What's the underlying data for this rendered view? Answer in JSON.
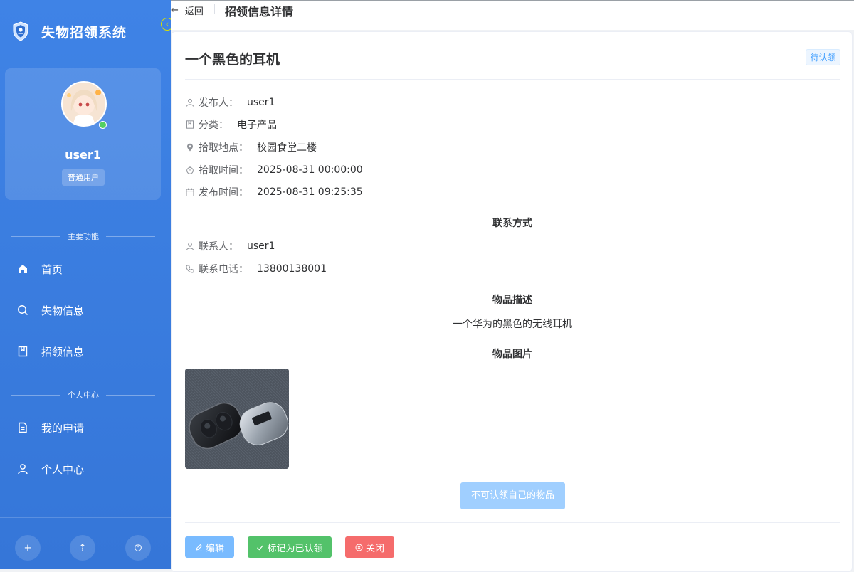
{
  "app": {
    "title": "失物招领系统"
  },
  "user": {
    "name": "user1",
    "role": "普通用户"
  },
  "sidebar": {
    "main_section": "主要功能",
    "personal_section": "个人中心",
    "main_items": [
      {
        "label": "首页",
        "icon": "home-icon"
      },
      {
        "label": "失物信息",
        "icon": "search-icon"
      },
      {
        "label": "招领信息",
        "icon": "bookmark-icon"
      }
    ],
    "personal_items": [
      {
        "label": "我的申请",
        "icon": "document-icon"
      },
      {
        "label": "个人中心",
        "icon": "user-icon"
      }
    ],
    "bottom_buttons": [
      {
        "icon": "plus-icon",
        "glyph": "+"
      },
      {
        "icon": "upload-icon",
        "glyph": "⇡"
      },
      {
        "icon": "power-icon",
        "glyph": "⏻"
      }
    ]
  },
  "header": {
    "back_label": "返回",
    "page_title": "招领信息详情"
  },
  "item": {
    "title": "一个黑色的耳机",
    "status": "待认领",
    "fields": [
      {
        "label": "发布人：",
        "value": "user1",
        "icon": "user-icon"
      },
      {
        "label": "分类：",
        "value": "电子产品",
        "icon": "category-icon"
      },
      {
        "label": "拾取地点：",
        "value": "校园食堂二楼",
        "icon": "location-icon"
      },
      {
        "label": "拾取时间：",
        "value": "2025-08-31 00:00:00",
        "icon": "stopwatch-icon"
      },
      {
        "label": "发布时间：",
        "value": "2025-08-31 09:25:35",
        "icon": "calendar-icon"
      }
    ],
    "contact_heading": "联系方式",
    "contact_fields": [
      {
        "label": "联系人：",
        "value": "user1",
        "icon": "user-icon"
      },
      {
        "label": "联系电话：",
        "value": "13800138001",
        "icon": "phone-icon"
      }
    ],
    "description_heading": "物品描述",
    "description": "一个华为的黑色的无线耳机",
    "images_heading": "物品图片",
    "claim_button": "不可认领自己的物品"
  },
  "actions": {
    "edit": "编辑",
    "mark_claimed": "标记为已认领",
    "close": "关闭"
  },
  "colors": {
    "sidebar": "#3f83e6",
    "primary": "#409eff",
    "success": "#53c26a",
    "danger": "#f56c6c"
  }
}
